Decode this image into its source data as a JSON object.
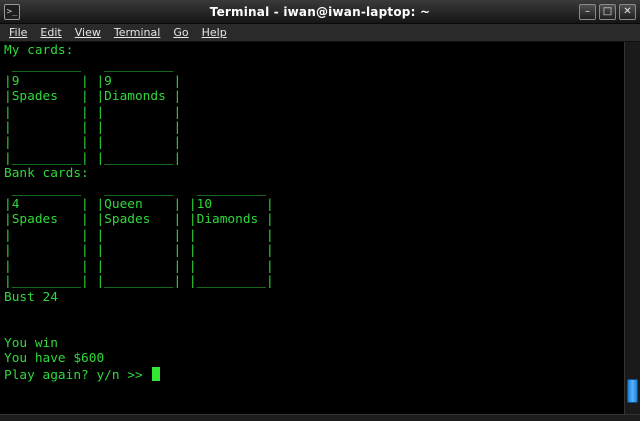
{
  "window": {
    "title": "Terminal - iwan@iwan-laptop: ~",
    "app_icon_label": ">_",
    "controls": {
      "minimize": "–",
      "maximize": "□",
      "close": "✕"
    }
  },
  "menubar": {
    "items": [
      "File",
      "Edit",
      "View",
      "Terminal",
      "Go",
      "Help"
    ]
  },
  "terminal": {
    "lines": [
      "My cards:",
      " _________   _________",
      "|9        | |9        |",
      "|Spades   | |Diamonds |",
      "|         | |         |",
      "|         | |         |",
      "|         | |         |",
      "|_________| |_________|",
      "Bank cards:",
      " _________   _________   _________",
      "|4        | |Queen    | |10       |",
      "|Spades   | |Spades   | |Diamonds |",
      "|         | |         | |         |",
      "|         | |         | |         |",
      "|         | |         | |         |",
      "|_________| |_________| |_________|",
      "Bust 24",
      "",
      "",
      "You win",
      "You have $600"
    ],
    "prompt": "Play again? y/n >> "
  },
  "colors": {
    "terminal_fg": "#2fd83a",
    "terminal_bg": "#000000",
    "cursor": "#32e832",
    "scrollbar_thumb": "#3a9cf0"
  }
}
